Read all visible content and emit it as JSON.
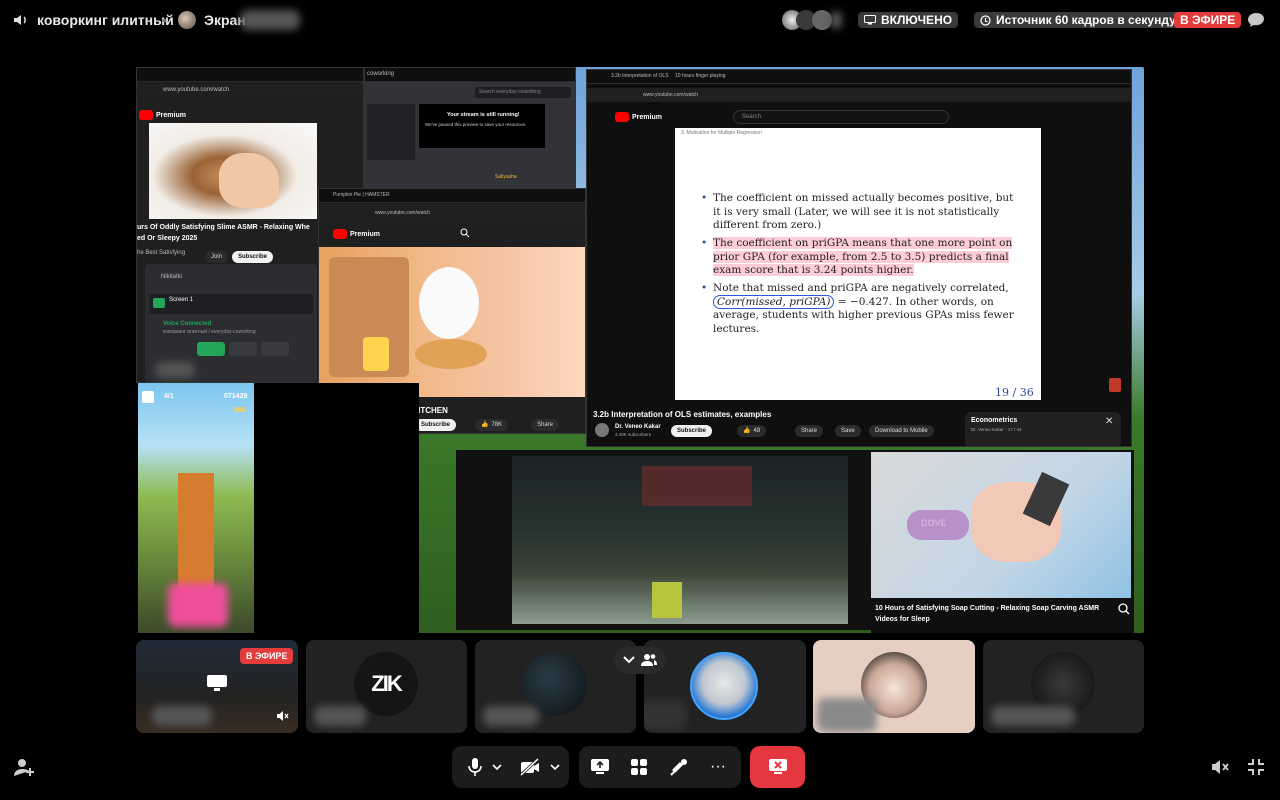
{
  "topbar": {
    "room_name": "коворкинг илитный",
    "screen_label": "Экран",
    "status_enabled": "ВКЛЮЧЕНО",
    "source_fps": "Источник 60 кадров в секунду",
    "live_badge": "В ЭФИРЕ"
  },
  "stage": {
    "win_left": {
      "url": "www.youtube.com/watch",
      "brand": "Premium",
      "title_line1": "urs Of Oddly Satisfying Slime ASMR - Relaxing Whe",
      "title_line2": "ed Or Sleepy 2025",
      "channel": "he Best Satisfying",
      "join": "Join",
      "subscribe": "Subscribe"
    },
    "discord_panel": {
      "user1": "Nikitatki",
      "screen_title": "Screen 1",
      "voice_connected": "Voice Connected",
      "voice_sub": "коворкинг илитный / everyday-coworking"
    },
    "win_coworking": {
      "tab": "coworking",
      "search_placeholder": "Search everyday-coworking",
      "stream_title": "Your stream is still running!",
      "stream_sub": "We've paused this preview to save your resources.",
      "user": "Sallyasha"
    },
    "win_hamster": {
      "tab": "Pumpkin Pie | HAMSTER",
      "url": "www.youtube.com/watch",
      "brand": "Premium",
      "title": "ER KITCHEN",
      "likes": "78K",
      "share": "Share",
      "subscribe": "Subscribe"
    },
    "win_econ": {
      "tab1": "3.2b Interpretation of OLS",
      "tab2": "10 hours finger playing",
      "url": "www.youtube.com/watch",
      "brand": "Premium",
      "search_placeholder": "Search",
      "slide_heading": "3. Motivation for Multiple Regression",
      "bullet1": "The coefficient on missed actually becomes positive, but it is very small (Later, we will see it is not statistically different from zero.)",
      "bullet2": "The coefficient on priGPA means that one more point on prior GPA (for example, from 2.5 to 3.5) predicts a final exam score that is 3.24 points higher.",
      "bullet3_a": "Note that missed and priGPA are negatively correlated,",
      "bullet3_formula": "Corr(missed, priGPA)",
      "bullet3_b": "= −0.427. In other words, on average, students with higher previous GPAs miss fewer lectures.",
      "page": "19 / 36",
      "video_title": "3.2b Interpretation of OLS estimates, examples",
      "channel": "Dr. Veneo Kakar",
      "subscribers": "4.48K subscribers",
      "subscribe": "Subscribe",
      "likes": "48",
      "share": "Share",
      "save": "Save",
      "download": "Download to Mobile",
      "playlist_title": "Econometrics",
      "playlist_sub": "Dr. Veneo Kakar · 17 / 44"
    },
    "game": {
      "score": "071429",
      "coins": "866",
      "level": "4/1"
    },
    "soap": {
      "title_line1": "10 Hours of Satisfying Soap Cutting - Relaxing Soap Carving ASMR",
      "title_line2": "Videos for Sleep",
      "soap_word": "DOVE"
    }
  },
  "participants": {
    "live_badge": "В ЭФИРЕ",
    "tile2_logo": "ZIK"
  },
  "colors": {
    "live_red": "#e23c3c",
    "end_call_red": "#e5373f",
    "accent_blue": "#3ea6ff"
  }
}
